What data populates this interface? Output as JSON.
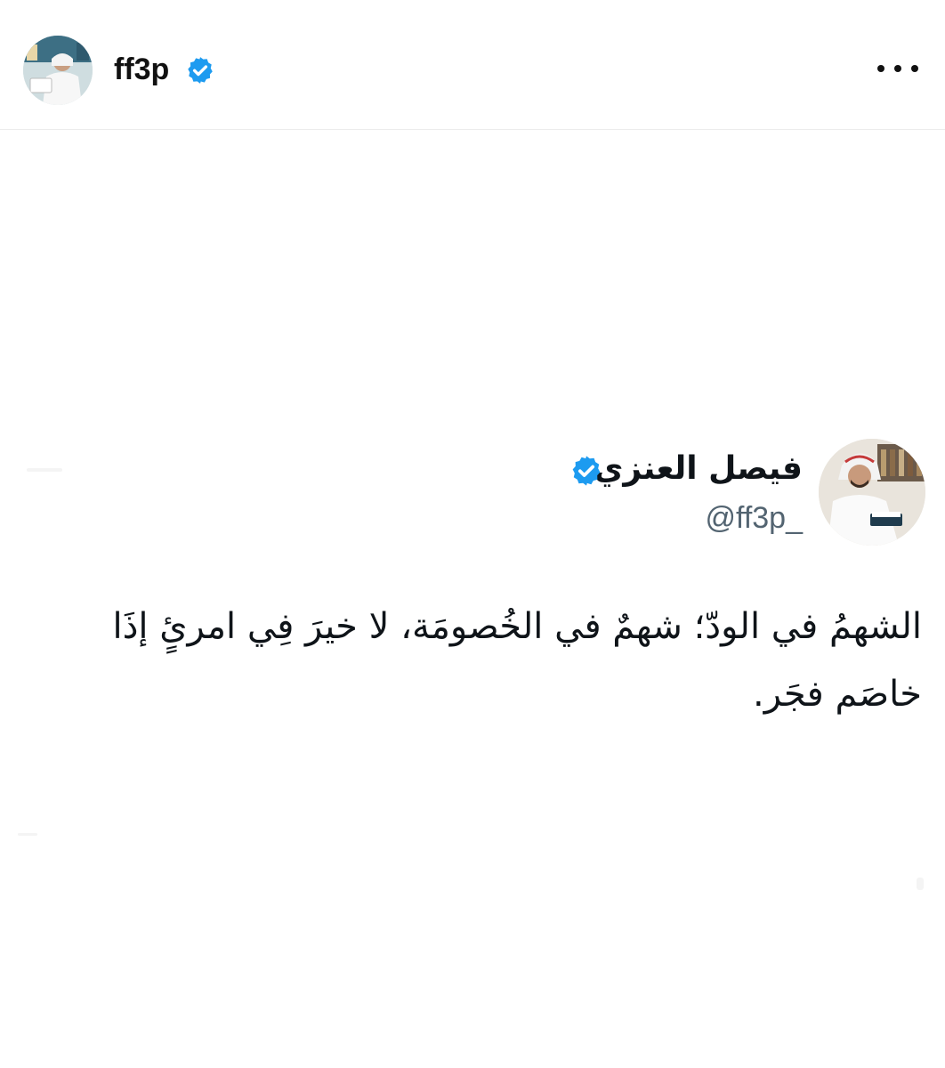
{
  "post_header": {
    "username": "ff3p",
    "avatar_icon": "profile-photo-icon",
    "verified_icon": "verified-badge-icon",
    "more_icon": "more-options-icon"
  },
  "tweet": {
    "display_name": "فيصل العنزي",
    "handle": "@ff3p_",
    "text": "الشهمُ في الودّ؛ شهمٌ في الخُصومَة، لا خيرَ فِي امرئٍ إذَا خاصَم فجَر.",
    "avatar_icon": "profile-photo-icon",
    "verified_icon": "verified-badge-icon"
  },
  "colors": {
    "verified_blue": "#1d9bf0",
    "text_primary": "#0f1419",
    "text_secondary": "#536471",
    "divider": "#ececec"
  }
}
